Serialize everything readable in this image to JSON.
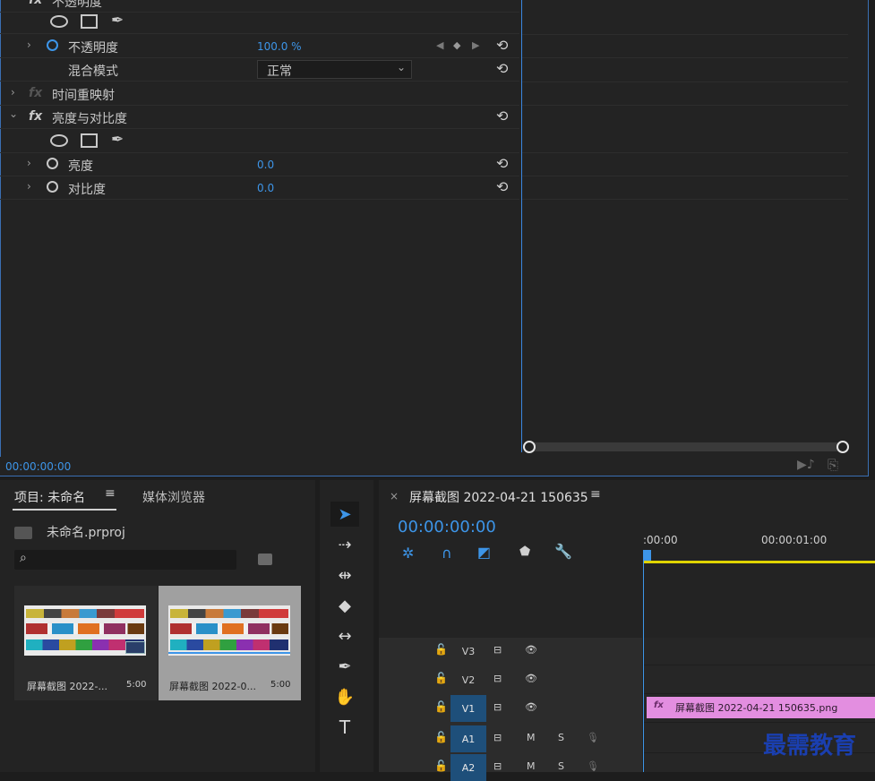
{
  "effect_controls": {
    "opacity_header": "不透明度",
    "opacity_row": {
      "label": "不透明度",
      "value": "100.0 %"
    },
    "blend_row": {
      "label": "混合模式",
      "value": "正常"
    },
    "time_remap": "时间重映射",
    "bc_header": "亮度与对比度",
    "brightness": {
      "label": "亮度",
      "value": "0.0"
    },
    "contrast": {
      "label": "对比度",
      "value": "0.0"
    },
    "timecode": "00:00:00:00"
  },
  "project": {
    "tab_project": "项目: 未命名",
    "tab_media": "媒体浏览器",
    "file_name": "未命名.prproj",
    "search_placeholder": "",
    "items": [
      {
        "name": "屏幕截图 2022-...",
        "duration": "5:00"
      },
      {
        "name": "屏幕截图 2022-0...",
        "duration": "5:00"
      }
    ]
  },
  "timeline": {
    "tab_title": "屏幕截图 2022-04-21 150635",
    "timecode": "00:00:00:00",
    "ruler": [
      ":00:00",
      "00:00:01:00"
    ],
    "tracks": [
      "V3",
      "V2",
      "V1",
      "A1",
      "A2"
    ],
    "mute": "M",
    "solo": "S",
    "clip_label": "屏幕截图 2022-04-21 150635.png"
  },
  "watermark": "最需教育",
  "colors": {
    "accent": "#3d95e8",
    "clip": "#e38ee0",
    "bg": "#232323",
    "playhead_line": "#e0d400"
  }
}
